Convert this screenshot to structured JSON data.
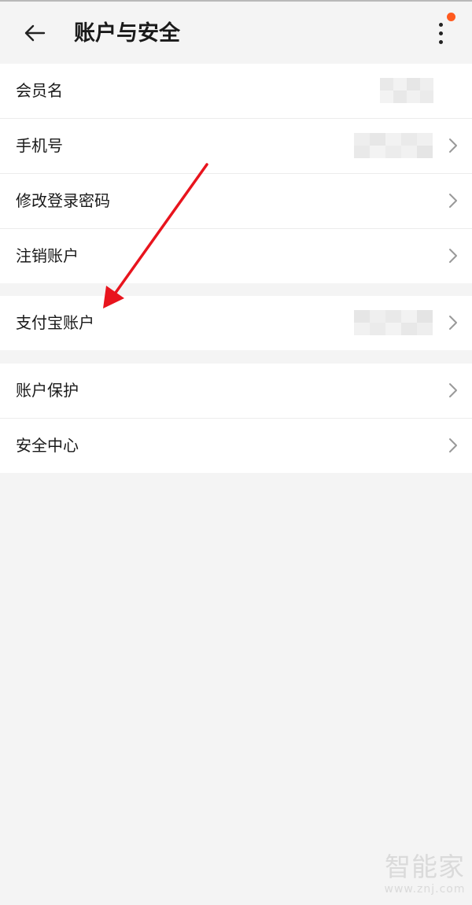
{
  "header": {
    "title": "账户与安全",
    "back_icon": "arrow-left-icon",
    "more_icon": "more-vertical-icon",
    "notification_dot_color": "#ff5a1f"
  },
  "groups": [
    {
      "rows": [
        {
          "label": "会员名",
          "value": "(pixelated)",
          "chevron": false
        },
        {
          "label": "手机号",
          "value": "(pixelated)",
          "chevron": true
        },
        {
          "label": "修改登录密码",
          "chevron": true
        },
        {
          "label": "注销账户",
          "chevron": true
        }
      ]
    },
    {
      "rows": [
        {
          "label": "支付宝账户",
          "value": "(pixelated)",
          "chevron": true
        }
      ]
    },
    {
      "rows": [
        {
          "label": "账户保护",
          "chevron": true
        },
        {
          "label": "安全中心",
          "chevron": true
        }
      ]
    }
  ],
  "annotation": {
    "type": "arrow",
    "color": "#e8141d",
    "target": "支付宝账户"
  },
  "watermark": {
    "title": "智能家",
    "url": "www.znj.com"
  },
  "colors": {
    "background": "#f4f4f4",
    "card": "#ffffff",
    "text": "#1a1a1a",
    "chevron": "#999999"
  }
}
